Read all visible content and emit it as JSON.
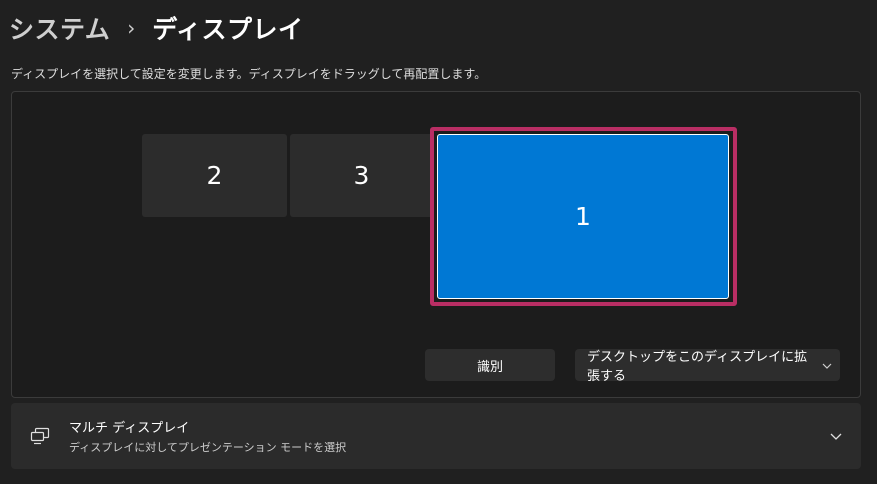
{
  "breadcrumb": {
    "parent": "システム",
    "separator": "›",
    "current": "ディスプレイ"
  },
  "instructions": "ディスプレイを選択して設定を変更します。ディスプレイをドラッグして再配置します。",
  "monitors": [
    {
      "label": "2",
      "selected": false
    },
    {
      "label": "3",
      "selected": false
    },
    {
      "label": "1",
      "selected": true
    }
  ],
  "buttons": {
    "identify_label": "識別",
    "mode_select_label": "デスクトップをこのディスプレイに拡張する"
  },
  "multi_display": {
    "title": "マルチ ディスプレイ",
    "subtitle": "ディスプレイに対してプレゼンテーション モードを選択"
  },
  "colors": {
    "accent": "#0078d4",
    "selection_outline": "#b92e64",
    "background": "#202020"
  },
  "icons": {
    "multi_display": "multi-display-icon",
    "expand": "chevron-down-icon"
  }
}
